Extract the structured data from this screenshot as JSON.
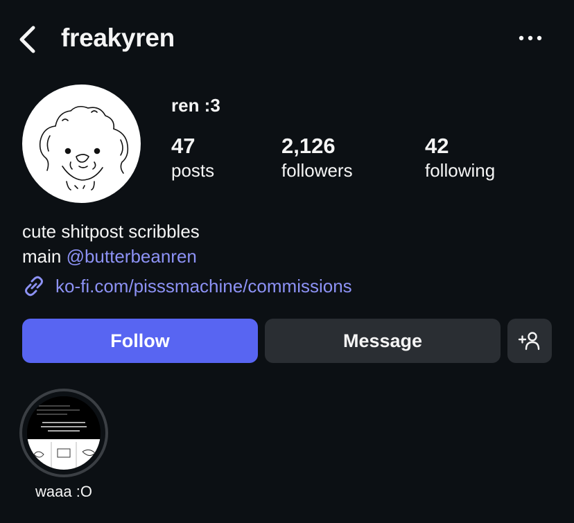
{
  "header": {
    "username": "freakyren"
  },
  "profile": {
    "display_name": "ren :3",
    "stats": [
      {
        "count": "47",
        "label": "posts"
      },
      {
        "count": "2,126",
        "label": "followers"
      },
      {
        "count": "42",
        "label": "following"
      }
    ],
    "bio_line1": "cute shitpost scribbles",
    "bio_line2_prefix": "main ",
    "bio_mention": "@butterbeanren",
    "link": "ko-fi.com/pisssmachine/commissions"
  },
  "actions": {
    "follow_label": "Follow",
    "message_label": "Message",
    "suggest_icon": "add-person-icon"
  },
  "highlights": [
    {
      "label": "waaa :O"
    }
  ],
  "colors": {
    "background": "#0c1014",
    "accent": "#5865f2",
    "link": "#8d92f5",
    "button_secondary": "#2a2e33"
  }
}
